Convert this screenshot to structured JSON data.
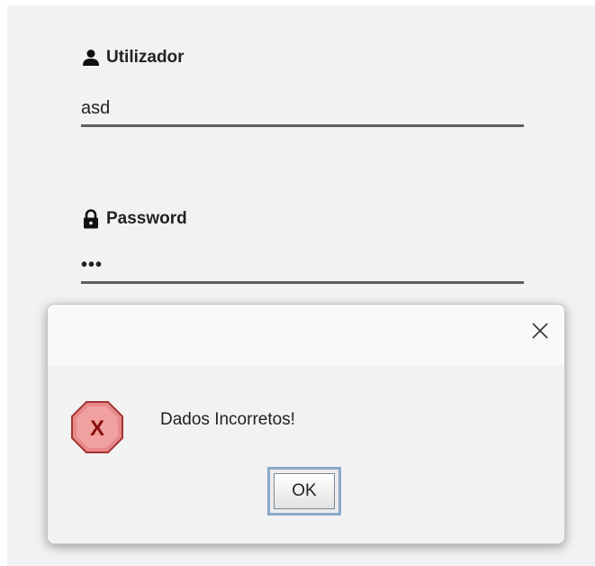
{
  "login": {
    "username": {
      "label": "Utilizador",
      "value": "asd",
      "icon": "user-icon"
    },
    "password": {
      "label": "Password",
      "value": "•••",
      "icon": "lock-icon"
    }
  },
  "dialog": {
    "message": "Dados Incorretos!",
    "ok_label": "OK",
    "icon": "error-icon",
    "close_icon": "close-icon",
    "error_color": "#e64a4a"
  }
}
